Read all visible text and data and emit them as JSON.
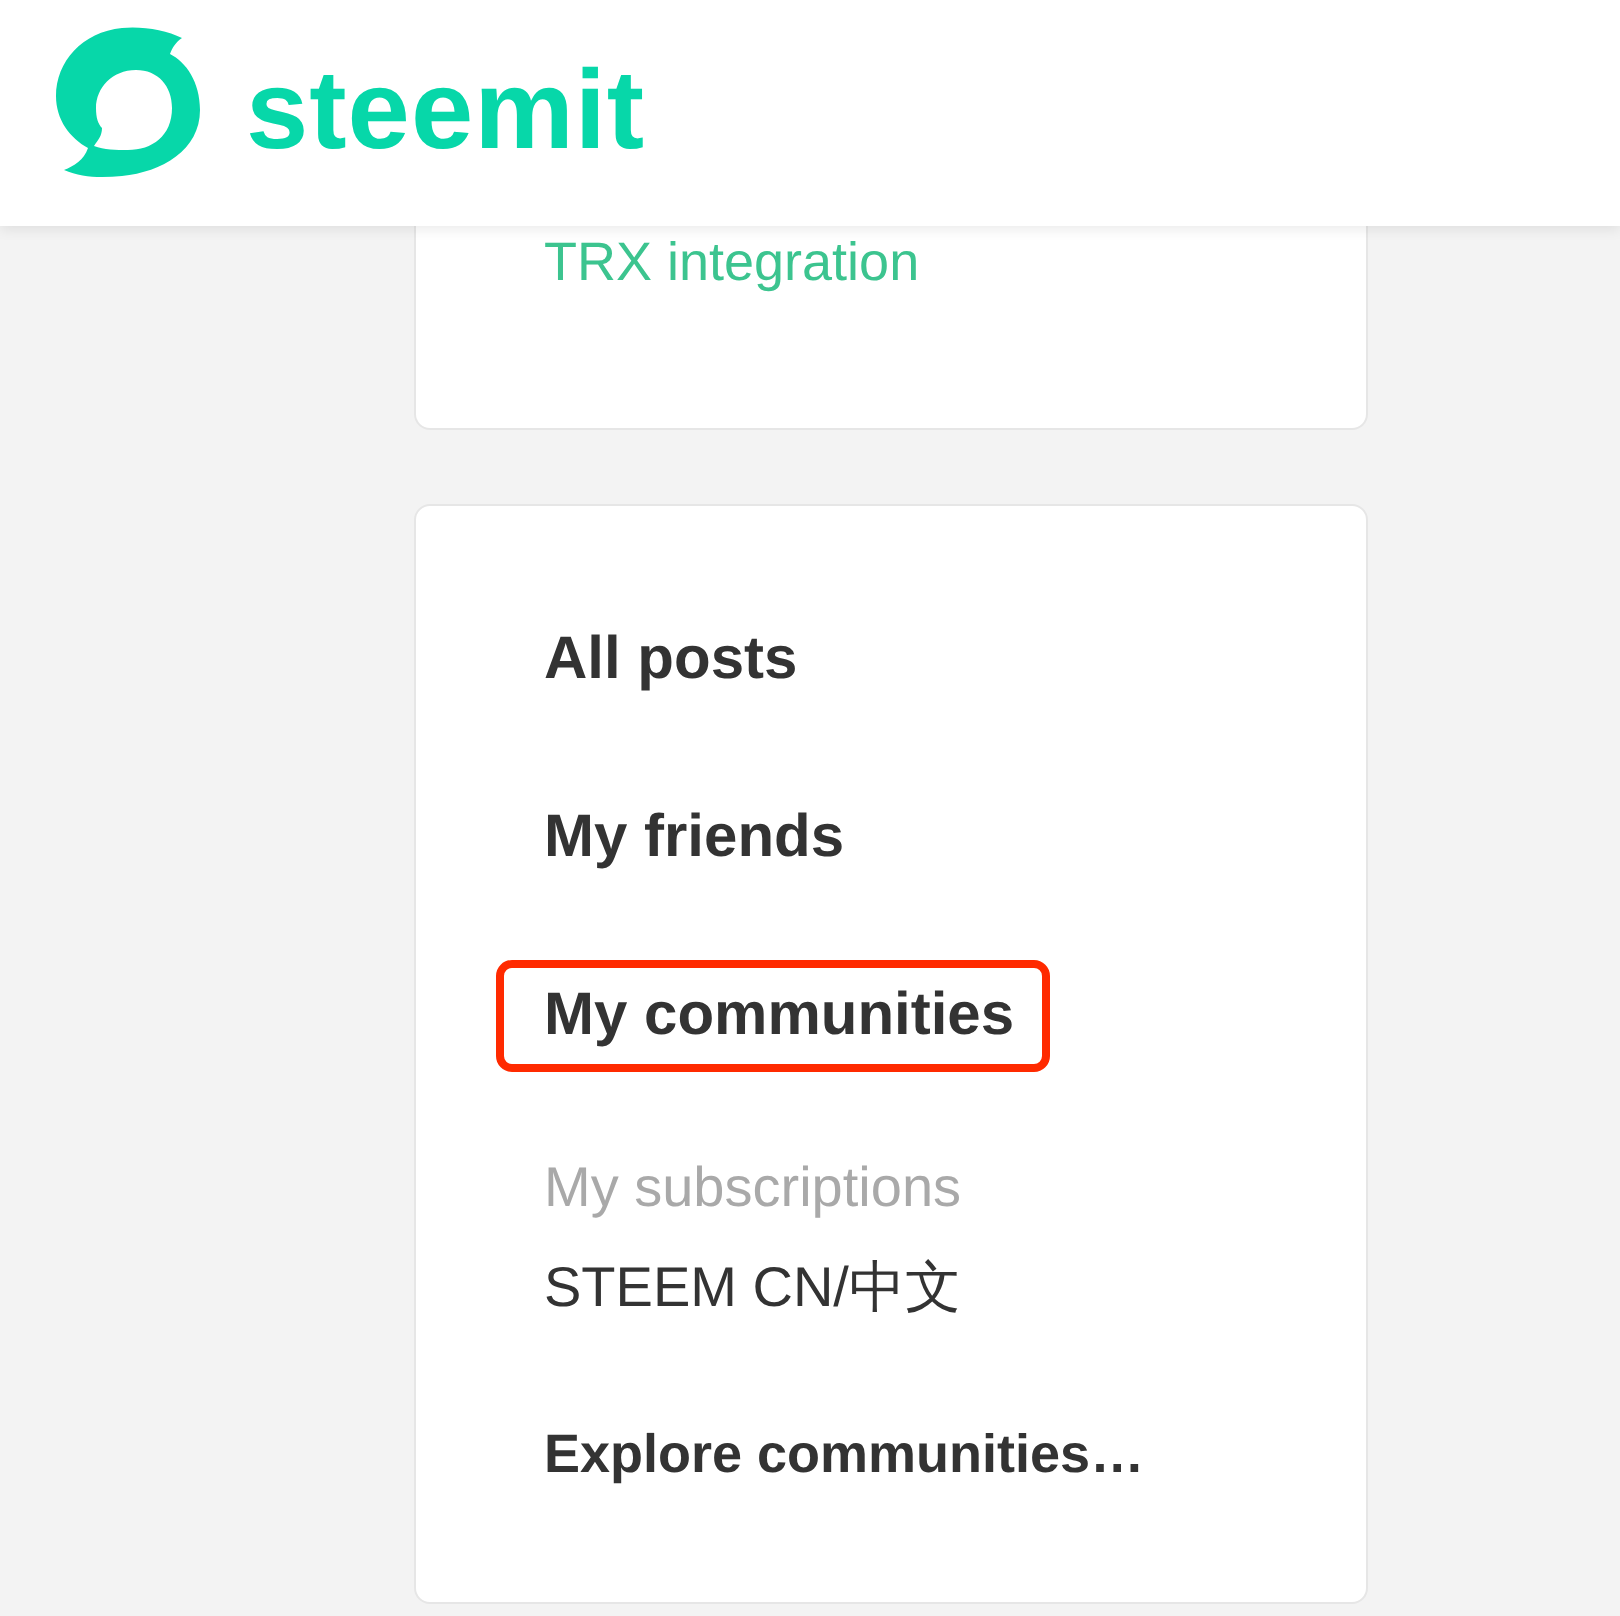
{
  "header": {
    "logo_text": "steemit"
  },
  "previous_card": {
    "link": "TRX integration"
  },
  "nav_card": {
    "items": [
      {
        "label": "All posts",
        "highlighted": false
      },
      {
        "label": "My friends",
        "highlighted": false
      },
      {
        "label": "My communities",
        "highlighted": true
      }
    ],
    "subscriptions": {
      "heading": "My subscriptions",
      "items": [
        "STEEM CN/中文"
      ]
    },
    "explore_link": "Explore communities…"
  }
}
